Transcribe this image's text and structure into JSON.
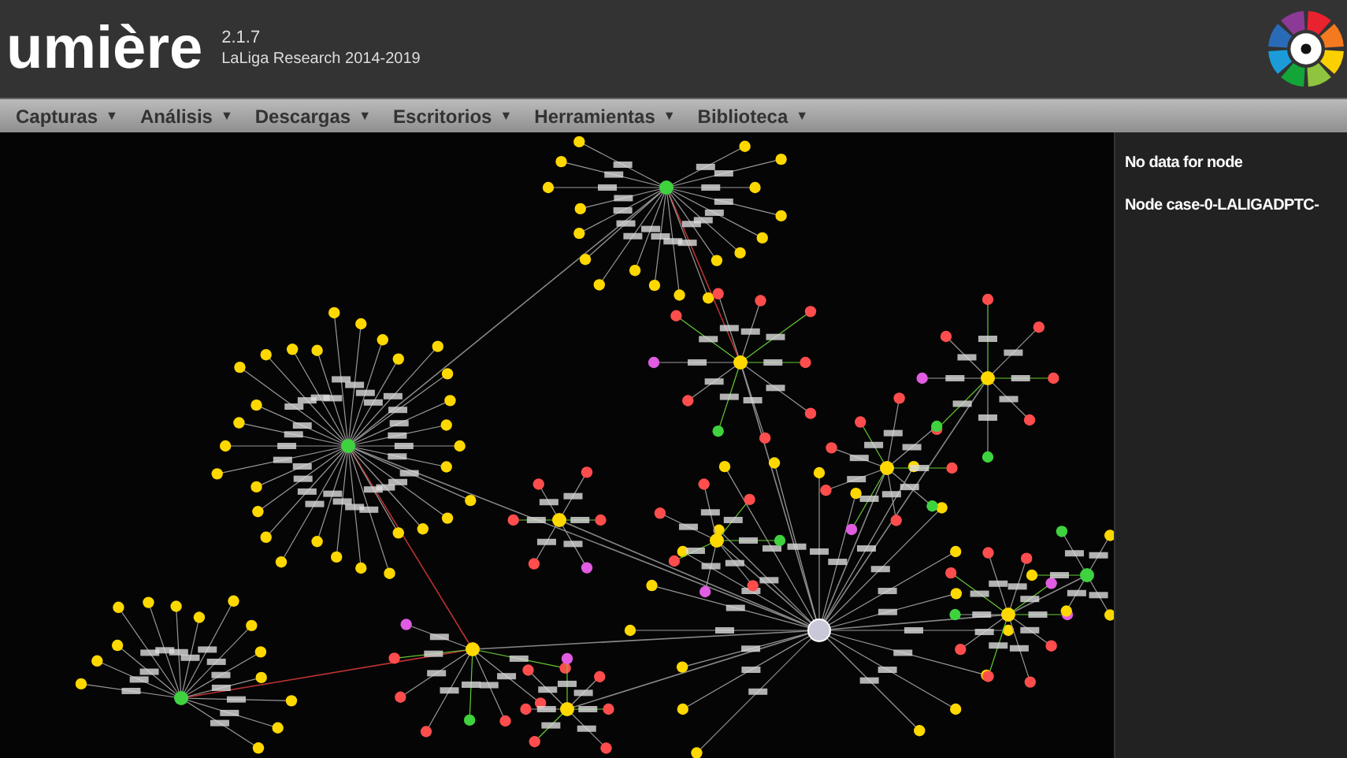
{
  "header": {
    "app_name": "umière",
    "version": "2.1.7",
    "subtitle": "LaLiga Research 2014-2019"
  },
  "menu": [
    {
      "label": "Capturas",
      "caret": "▼"
    },
    {
      "label": "Análisis",
      "caret": "▼"
    },
    {
      "label": "Descargas",
      "caret": "▼"
    },
    {
      "label": "Escritorios",
      "caret": "▼"
    },
    {
      "label": "Herramientas",
      "caret": "▼"
    },
    {
      "label": "Biblioteca",
      "caret": "▼"
    }
  ],
  "side_panel": {
    "lines": [
      "No data for node",
      "Node case-0-LALIGADPTC-"
    ]
  }
}
